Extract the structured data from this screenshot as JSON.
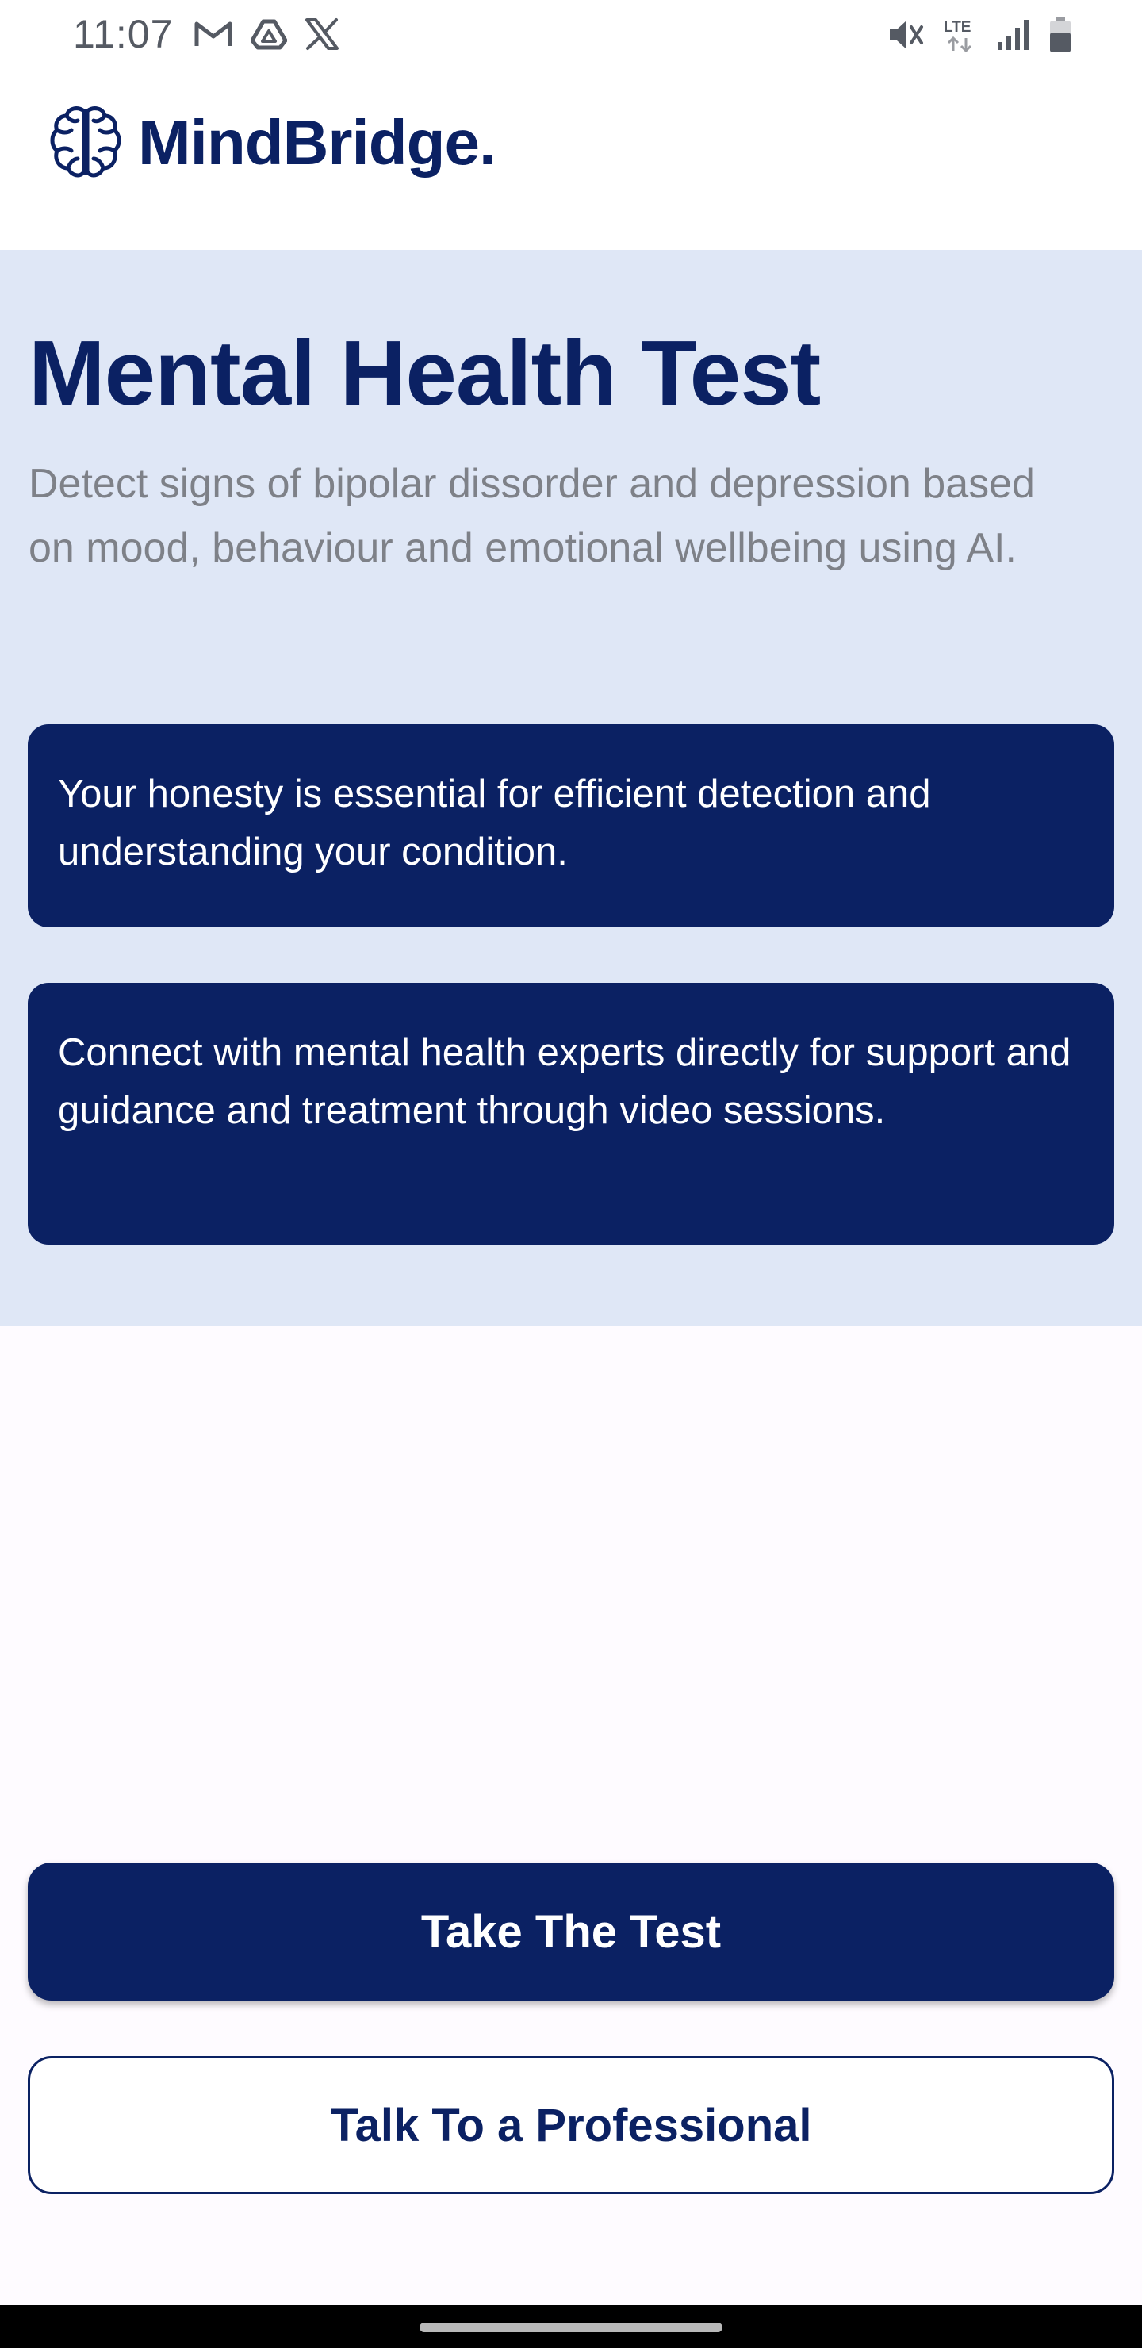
{
  "status_bar": {
    "time": "11:07",
    "left_icons": [
      "gmail-icon",
      "drive-icon",
      "x-icon"
    ],
    "right_icons": [
      "mute-icon",
      "lte-icon",
      "signal-icon",
      "battery-icon"
    ],
    "network_label": "LTE"
  },
  "header": {
    "app_name": "MindBridge.",
    "brand_color": "#0b2163"
  },
  "hero": {
    "title": "Mental Health Test",
    "subtitle": "Detect signs of bipolar dissorder and depression based on mood, behaviour and emotional wellbeing using AI.",
    "background_color": "#dfe7f6"
  },
  "cards": [
    {
      "text": "Your honesty is essential for efficient detection and understanding your condition."
    },
    {
      "text": "Connect with mental health experts directly for support and guidance and treatment through video sessions."
    }
  ],
  "actions": {
    "primary_label": "Take The Test",
    "secondary_label": "Talk To a Professional"
  }
}
